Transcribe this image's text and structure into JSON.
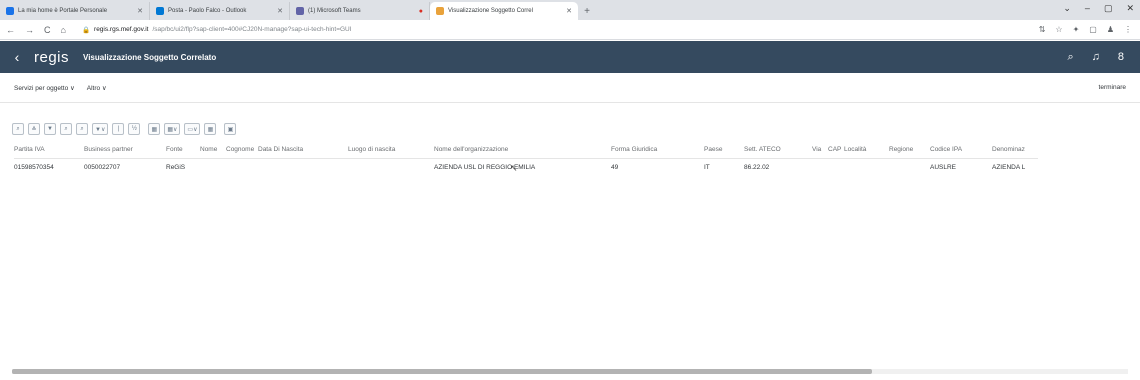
{
  "browser": {
    "tabs": [
      {
        "label": "La mia home è Portale Personale",
        "icon_color": "#1a73e8"
      },
      {
        "label": "Posta - Paolo Falco - Outlook",
        "icon_color": "#0078d4"
      },
      {
        "label": "(1) Microsoft Teams",
        "icon_color": "#6264a7"
      },
      {
        "label": "Visualizzazione Soggetto Correl",
        "icon_color": "#e9a23b",
        "active": true
      }
    ],
    "new_tab": "+",
    "window_controls": [
      "⌄",
      "–",
      "▢",
      "✕"
    ],
    "nav": [
      "←",
      "→",
      "C",
      "⌂"
    ],
    "url_host": "regis.rgs.mef.gov.it",
    "url_rest": "/sap/bc/ui2/flp?sap-client=400#CJ20N-manage?sap-ui-tech-hint=GUI",
    "toolbar_icons": [
      "⇅",
      "☆",
      "✦",
      "▢",
      "♟",
      "⋮"
    ]
  },
  "shell": {
    "back": "‹",
    "logo": "regis",
    "title": "Visualizzazione Soggetto Correlato",
    "icons": [
      "⌕",
      "♫",
      "8"
    ]
  },
  "subheader": {
    "menu": [
      "Servizi per oggetto ∨",
      "Altro ∨"
    ],
    "end": "terminare"
  },
  "toolbar": [
    "⌕",
    "≜",
    "▼",
    "⌕",
    "⌕",
    "▼∨",
    "|",
    "½",
    "▦",
    "▦∨",
    "▭∨",
    "▦",
    "▣"
  ],
  "table": {
    "columns": [
      "Partita IVA",
      "Business partner",
      "Fonte",
      "Nome",
      "Cognome",
      "Data Di Nascita",
      "Luogo di nascita",
      "Nome dell'organizzazione",
      "Forma Giuridica",
      "Paese",
      "Sett. ATECO",
      "Via",
      "CAP",
      "Località",
      "Regione",
      "Codice IPA",
      "Denominaz"
    ],
    "rows": [
      [
        "01598570354",
        "0050022707",
        "ReGiS",
        "",
        "",
        "",
        "",
        "AZIENDA USL DI REGGIO EMILIA",
        "49",
        "IT",
        "86.22.02",
        "",
        "",
        "",
        "",
        "AUSLRE",
        "AZIENDA L"
      ]
    ]
  }
}
